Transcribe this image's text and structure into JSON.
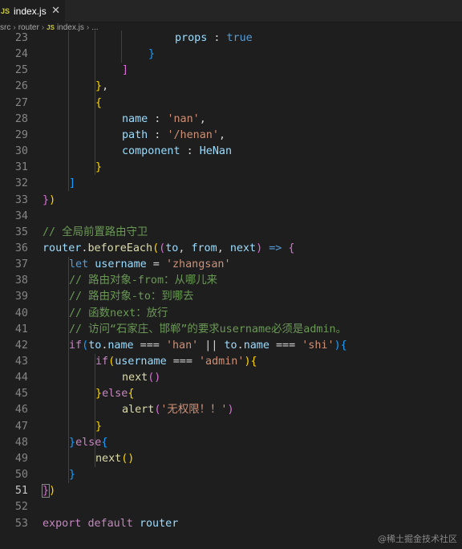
{
  "tab": {
    "icon": "JS",
    "filename": "index.js",
    "close": "✕"
  },
  "breadcrumb": {
    "parts": [
      "src",
      "router",
      "index.js",
      "..."
    ],
    "file_icon": "JS"
  },
  "lines": [
    {
      "n": "23",
      "tokens": [
        [
          "v",
          "props"
        ],
        [
          "p",
          " : "
        ],
        [
          "sk",
          "true"
        ]
      ]
    },
    {
      "n": "24",
      "tokens": [
        [
          "b3",
          "}"
        ]
      ]
    },
    {
      "n": "25",
      "tokens": [
        [
          "b2",
          "]"
        ]
      ]
    },
    {
      "n": "26",
      "tokens": [
        [
          "b1",
          "}"
        ],
        [
          "p",
          ","
        ]
      ]
    },
    {
      "n": "27",
      "tokens": [
        [
          "b1",
          "{"
        ]
      ]
    },
    {
      "n": "28",
      "tokens": [
        [
          "v",
          "name"
        ],
        [
          "p",
          " : "
        ],
        [
          "s",
          "'nan'"
        ],
        [
          "p",
          ","
        ]
      ]
    },
    {
      "n": "29",
      "tokens": [
        [
          "v",
          "path"
        ],
        [
          "p",
          " : "
        ],
        [
          "s",
          "'/henan'"
        ],
        [
          "p",
          ","
        ]
      ]
    },
    {
      "n": "30",
      "tokens": [
        [
          "v",
          "component"
        ],
        [
          "p",
          " : "
        ],
        [
          "v",
          "HeNan"
        ]
      ]
    },
    {
      "n": "31",
      "tokens": [
        [
          "b1",
          "}"
        ]
      ]
    },
    {
      "n": "32",
      "tokens": [
        [
          "b3",
          "]"
        ]
      ]
    },
    {
      "n": "33",
      "tokens": [
        [
          "b2",
          "}"
        ],
        [
          "b1",
          ")"
        ]
      ]
    },
    {
      "n": "34",
      "tokens": []
    },
    {
      "n": "35",
      "tokens": [
        [
          "c",
          "// 全局前置路由守卫"
        ]
      ]
    },
    {
      "n": "36",
      "tokens": [
        [
          "v",
          "router"
        ],
        [
          "p",
          "."
        ],
        [
          "f",
          "beforeEach"
        ],
        [
          "b1",
          "("
        ],
        [
          "b2",
          "("
        ],
        [
          "v",
          "to"
        ],
        [
          "p",
          ", "
        ],
        [
          "v",
          "from"
        ],
        [
          "p",
          ", "
        ],
        [
          "v",
          "next"
        ],
        [
          "b2",
          ")"
        ],
        [
          "p",
          " "
        ],
        [
          "sk",
          "=>"
        ],
        [
          "p",
          " "
        ],
        [
          "b2",
          "{"
        ]
      ]
    },
    {
      "n": "37",
      "tokens": [
        [
          "sk",
          "let"
        ],
        [
          "p",
          " "
        ],
        [
          "v",
          "username"
        ],
        [
          "p",
          " = "
        ],
        [
          "s",
          "'zhangsan'"
        ]
      ]
    },
    {
      "n": "38",
      "tokens": [
        [
          "c",
          "// 路由对象-from：从哪儿来"
        ]
      ]
    },
    {
      "n": "39",
      "tokens": [
        [
          "c",
          "// 路由对象-to：到哪去"
        ]
      ]
    },
    {
      "n": "40",
      "tokens": [
        [
          "c",
          "// 函数next：放行"
        ]
      ]
    },
    {
      "n": "41",
      "tokens": [
        [
          "c",
          "// 访问“石家庄、邯郸”的要求username必须是admin。"
        ]
      ]
    },
    {
      "n": "42",
      "tokens": [
        [
          "k",
          "if"
        ],
        [
          "b3",
          "("
        ],
        [
          "v",
          "to"
        ],
        [
          "p",
          "."
        ],
        [
          "v",
          "name"
        ],
        [
          "p",
          " === "
        ],
        [
          "s",
          "'han'"
        ],
        [
          "p",
          " || "
        ],
        [
          "v",
          "to"
        ],
        [
          "p",
          "."
        ],
        [
          "v",
          "name"
        ],
        [
          "p",
          " === "
        ],
        [
          "s",
          "'shi'"
        ],
        [
          "b3",
          ")"
        ],
        [
          "b3",
          "{"
        ]
      ]
    },
    {
      "n": "43",
      "tokens": [
        [
          "k",
          "if"
        ],
        [
          "b1",
          "("
        ],
        [
          "v",
          "username"
        ],
        [
          "p",
          " === "
        ],
        [
          "s",
          "'admin'"
        ],
        [
          "b1",
          ")"
        ],
        [
          "b1",
          "{"
        ]
      ]
    },
    {
      "n": "44",
      "tokens": [
        [
          "f",
          "next"
        ],
        [
          "b2",
          "()"
        ]
      ]
    },
    {
      "n": "45",
      "tokens": [
        [
          "b1",
          "}"
        ],
        [
          "k",
          "else"
        ],
        [
          "b1",
          "{"
        ]
      ]
    },
    {
      "n": "46",
      "tokens": [
        [
          "f",
          "alert"
        ],
        [
          "b2",
          "("
        ],
        [
          "s",
          "'无权限！！'"
        ],
        [
          "b2",
          ")"
        ]
      ]
    },
    {
      "n": "47",
      "tokens": [
        [
          "b1",
          "}"
        ]
      ]
    },
    {
      "n": "48",
      "tokens": [
        [
          "b3",
          "}"
        ],
        [
          "k",
          "else"
        ],
        [
          "b3",
          "{"
        ]
      ]
    },
    {
      "n": "49",
      "tokens": [
        [
          "f",
          "next"
        ],
        [
          "b1",
          "()"
        ]
      ]
    },
    {
      "n": "50",
      "tokens": [
        [
          "b3",
          "}"
        ]
      ]
    },
    {
      "n": "51",
      "tokens": [
        [
          "b2",
          "}"
        ],
        [
          "b1",
          ")"
        ]
      ]
    },
    {
      "n": "52",
      "tokens": []
    },
    {
      "n": "53",
      "tokens": [
        [
          "k",
          "export"
        ],
        [
          "p",
          " "
        ],
        [
          "k",
          "default"
        ],
        [
          "p",
          " "
        ],
        [
          "v",
          "router"
        ]
      ]
    }
  ],
  "watermark": "@稀土掘金技术社区"
}
